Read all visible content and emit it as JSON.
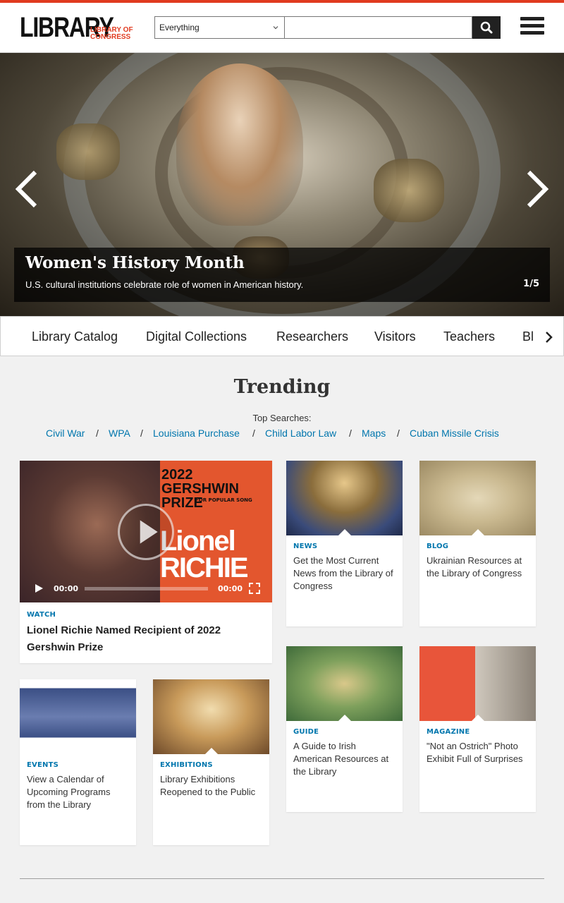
{
  "header": {
    "logo_main": "LIBRARY",
    "logo_sub": "LIBRARY OF CONGRESS",
    "search_scope": "Everything",
    "search_placeholder": "",
    "accent_color": "#e03a1f"
  },
  "hero": {
    "title": "Women's History Month",
    "subtitle": "U.S. cultural institutions celebrate role of women in American history.",
    "counter": "1/5"
  },
  "nav_tabs": [
    "Library Catalog",
    "Digital Collections",
    "Researchers",
    "Visitors",
    "Teachers",
    "Bl"
  ],
  "trending": {
    "title": "Trending",
    "top_searches_label": "Top Searches:",
    "links": [
      "Civil War",
      "WPA",
      "Louisiana Purchase",
      "Child Labor Law",
      "Maps",
      "Cuban Missile Crisis"
    ],
    "separator": "/"
  },
  "video_card": {
    "poster_line1": "2022 GERSHWIN PRIZE",
    "poster_line2": "FOR POPULAR SONG",
    "poster_name": "Lionel RICHIE",
    "time_current": "00:00",
    "time_total": "00:00",
    "category": "WATCH",
    "title": "Lionel Richie Named Recipient of 2022 Gershwin Prize"
  },
  "cards": [
    {
      "category": "NEWS",
      "title": "Get the Most Current News from the Library of Congress"
    },
    {
      "category": "BLOG",
      "title": "Ukrainian Resources at the Library of Congress"
    },
    {
      "category": "EVENTS",
      "title": "View a Calendar of Upcoming Programs from the Library"
    },
    {
      "category": "EXHIBITIONS",
      "title": "Library Exhibitions Reopened to the Public"
    },
    {
      "category": "GUIDE",
      "title": "A Guide to Irish American Resources at the Library"
    },
    {
      "category": "MAGAZINE",
      "title": "\"Not an Ostrich\" Photo Exhibit Full of Surprises"
    }
  ],
  "icons": {
    "search": "search-icon",
    "menu": "hamburger-menu-icon",
    "prev": "chevron-left-icon",
    "next": "chevron-right-icon"
  }
}
